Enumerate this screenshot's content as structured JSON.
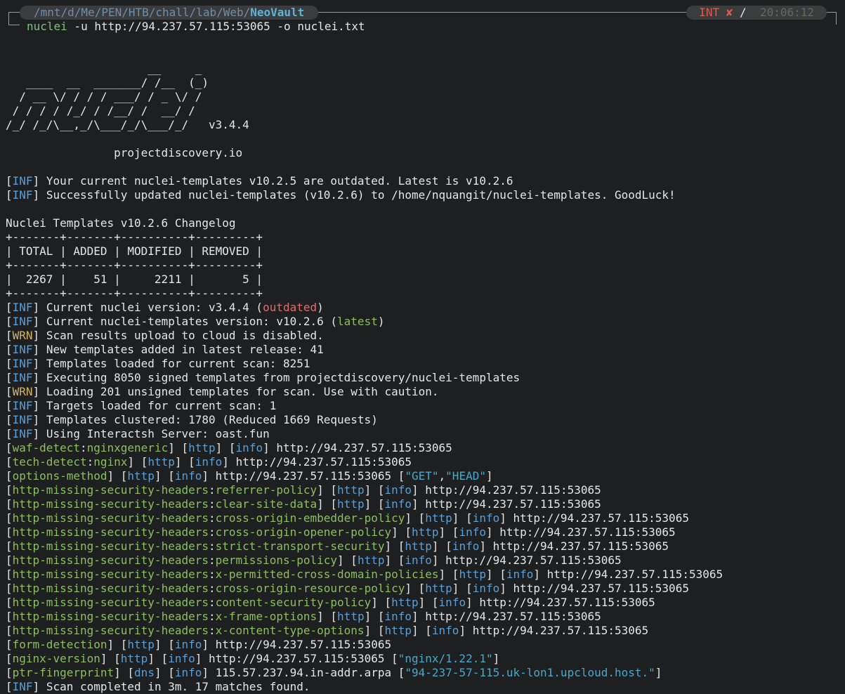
{
  "prompt": {
    "path_prefix": "/mnt/d/Me/PEN/HTB/chall/lab/Web/",
    "path_last": "NeoVault",
    "status_int": "INT",
    "status_x": "✘",
    "status_time": "20:06:12"
  },
  "command": {
    "name": "nuclei",
    "args": " -u http://94.237.57.115:53065 -o nuclei.txt"
  },
  "banner": {
    "art": [
      "",
      "                     __     _",
      "   ____  __  _______/ /__  (_)",
      "  / __ \\/ / / / ___/ / _ \\/ /",
      " / / / / /_/ / /__/ /  __/ /",
      "/_/ /_/\\__,_/\\___/_/\\___/_/   v3.4.4",
      "",
      "                projectdiscovery.io",
      ""
    ]
  },
  "update_lines": [
    {
      "tag": "INF",
      "text": " Your current nuclei-templates v10.2.5 are outdated. Latest is v10.2.6"
    },
    {
      "tag": "INF",
      "text": " Successfully updated nuclei-templates (v10.2.6) to /home/nquangit/nuclei-templates. GoodLuck!"
    }
  ],
  "changelog": {
    "title": "Nuclei Templates v10.2.6 Changelog",
    "border": "+-------+-------+----------+---------+",
    "header": "| TOTAL | ADDED | MODIFIED | REMOVED |",
    "row": "|  2267 |    51 |     2211 |       5 |"
  },
  "status_lines": {
    "l1": {
      "tag": "INF",
      "pre": " Current nuclei version: v3.4.4 (",
      "hl": "outdated",
      "post": ")"
    },
    "l2": {
      "tag": "INF",
      "pre": " Current nuclei-templates version: v10.2.6 (",
      "hl": "latest",
      "post": ")"
    },
    "l3": {
      "tag": "WRN",
      "text": " Scan results upload to cloud is disabled."
    },
    "l4": {
      "tag": "INF",
      "text": " New templates added in latest release: 41"
    },
    "l5": {
      "tag": "INF",
      "text": " Templates loaded for current scan: 8251"
    },
    "l6": {
      "tag": "INF",
      "text": " Executing 8050 signed templates from projectdiscovery/nuclei-templates"
    },
    "l7": {
      "tag": "WRN",
      "text": " Loading 201 unsigned templates for scan. Use with caution."
    },
    "l8": {
      "tag": "INF",
      "text": " Targets loaded for current scan: 1"
    },
    "l9": {
      "tag": "INF",
      "text": " Templates clustered: 1780 (Reduced 1669 Requests)"
    },
    "l10": {
      "tag": "INF",
      "text": " Using Interactsh Server: oast.fun"
    }
  },
  "findings": [
    {
      "id": "waf-detect",
      "sub": "nginxgeneric",
      "proto": "http",
      "sev": "info",
      "url": "http://94.237.57.115:53065",
      "extra": ""
    },
    {
      "id": "tech-detect",
      "sub": "nginx",
      "proto": "http",
      "sev": "info",
      "url": "http://94.237.57.115:53065",
      "extra": ""
    },
    {
      "id": "options-method",
      "sub": "",
      "proto": "http",
      "sev": "info",
      "url": "http://94.237.57.115:53065",
      "extra": "\"GET\",\"HEAD\""
    },
    {
      "id": "http-missing-security-headers",
      "sub": "referrer-policy",
      "proto": "http",
      "sev": "info",
      "url": "http://94.237.57.115:53065",
      "extra": ""
    },
    {
      "id": "http-missing-security-headers",
      "sub": "clear-site-data",
      "proto": "http",
      "sev": "info",
      "url": "http://94.237.57.115:53065",
      "extra": ""
    },
    {
      "id": "http-missing-security-headers",
      "sub": "cross-origin-embedder-policy",
      "proto": "http",
      "sev": "info",
      "url": "http://94.237.57.115:53065",
      "extra": ""
    },
    {
      "id": "http-missing-security-headers",
      "sub": "cross-origin-opener-policy",
      "proto": "http",
      "sev": "info",
      "url": "http://94.237.57.115:53065",
      "extra": ""
    },
    {
      "id": "http-missing-security-headers",
      "sub": "strict-transport-security",
      "proto": "http",
      "sev": "info",
      "url": "http://94.237.57.115:53065",
      "extra": ""
    },
    {
      "id": "http-missing-security-headers",
      "sub": "permissions-policy",
      "proto": "http",
      "sev": "info",
      "url": "http://94.237.57.115:53065",
      "extra": ""
    },
    {
      "id": "http-missing-security-headers",
      "sub": "x-permitted-cross-domain-policies",
      "proto": "http",
      "sev": "info",
      "url": "http://94.237.57.115:53065",
      "extra": ""
    },
    {
      "id": "http-missing-security-headers",
      "sub": "cross-origin-resource-policy",
      "proto": "http",
      "sev": "info",
      "url": "http://94.237.57.115:53065",
      "extra": ""
    },
    {
      "id": "http-missing-security-headers",
      "sub": "content-security-policy",
      "proto": "http",
      "sev": "info",
      "url": "http://94.237.57.115:53065",
      "extra": ""
    },
    {
      "id": "http-missing-security-headers",
      "sub": "x-frame-options",
      "proto": "http",
      "sev": "info",
      "url": "http://94.237.57.115:53065",
      "extra": ""
    },
    {
      "id": "http-missing-security-headers",
      "sub": "x-content-type-options",
      "proto": "http",
      "sev": "info",
      "url": "http://94.237.57.115:53065",
      "extra": ""
    },
    {
      "id": "form-detection",
      "sub": "",
      "proto": "http",
      "sev": "info",
      "url": "http://94.237.57.115:53065",
      "extra": ""
    },
    {
      "id": "nginx-version",
      "sub": "",
      "proto": "http",
      "sev": "info",
      "url": "http://94.237.57.115:53065",
      "extra": "\"nginx/1.22.1\""
    },
    {
      "id": "ptr-fingerprint",
      "sub": "",
      "proto": "dns",
      "sev": "info",
      "url": "115.57.237.94.in-addr.arpa",
      "extra": "\"94-237-57-115.uk-lon1.upcloud.host.\""
    }
  ],
  "final_line": {
    "tag": "INF",
    "text": " Scan completed in 3m. 17 matches found."
  }
}
